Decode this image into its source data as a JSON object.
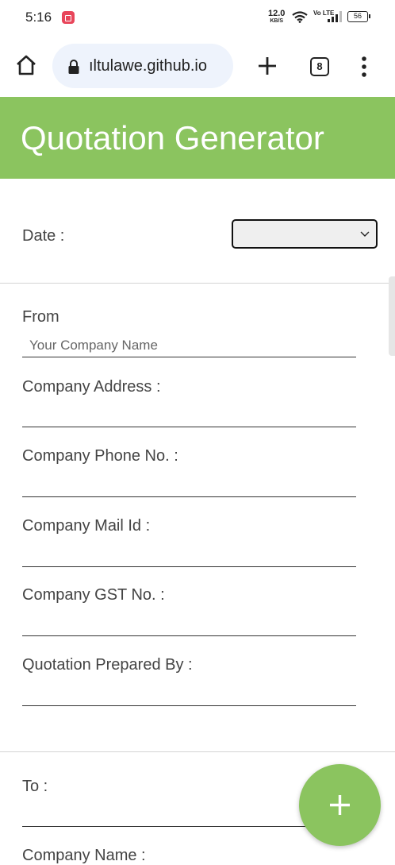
{
  "status_bar": {
    "time": "5:16",
    "speed_value": "12.0",
    "speed_unit": "KB/S",
    "network": "Vo LTE",
    "battery": "56"
  },
  "browser": {
    "url": "ıltulawe.github.io",
    "tab_count": "8"
  },
  "page": {
    "title": "Quotation Generator",
    "date_label": "Date :",
    "from_section": {
      "heading": "From",
      "company_name_placeholder": "Your Company Name",
      "address_label": "Company Address :",
      "phone_label": "Company Phone No. :",
      "mail_label": "Company Mail Id :",
      "gst_label": "Company GST No. :",
      "prepared_by_label": "Quotation Prepared By :"
    },
    "to_section": {
      "heading": "To :",
      "company_name_label": "Company Name :"
    }
  },
  "colors": {
    "accent": "#8bc45f"
  }
}
